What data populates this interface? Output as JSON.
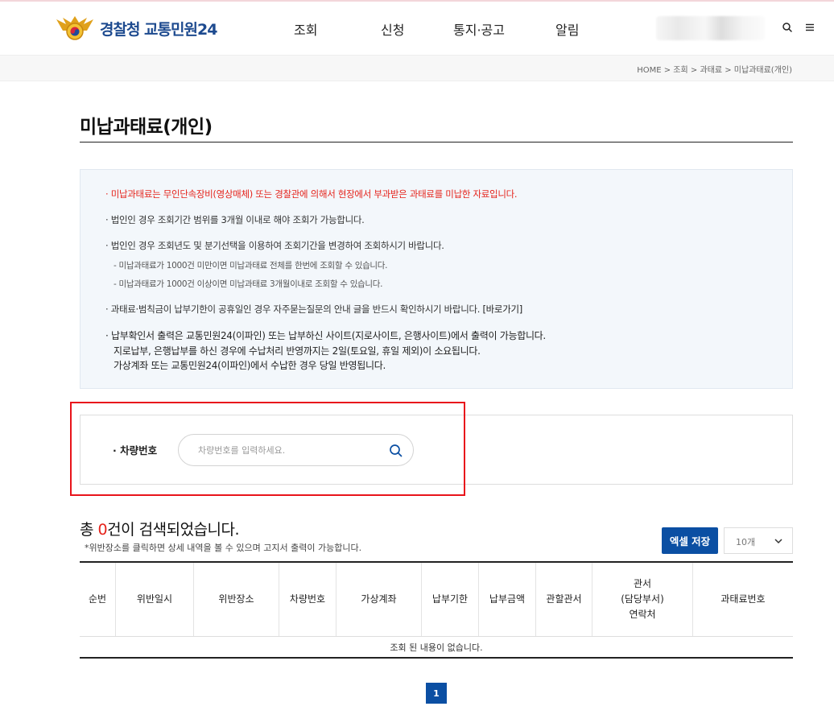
{
  "header": {
    "logo_text": "경찰청 교통민원24",
    "nav": [
      {
        "label": "조회"
      },
      {
        "label": "신청"
      },
      {
        "label": "통지·공고"
      },
      {
        "label": "알림"
      }
    ]
  },
  "breadcrumb": [
    "HOME",
    "조회",
    "과태료",
    "미납과태료(개인)"
  ],
  "page_title": "미납과태료(개인)",
  "notice": {
    "line1": "미납과태료는 무인단속장비(영상매체) 또는 경찰관에 의해서 현장에서 부과받은 과태료를 미납한 자료입니다.",
    "line2": "법인인 경우 조회기간 범위를 3개월 이내로 해야 조회가 가능합니다.",
    "line3": "법인인 경우 조회년도 및 분기선택을 이용하여 조회기간을 변경하여 조회하시기 바랍니다.",
    "line3_sub1": "미납과태료가 1000건 미만이면 미납과태료 전체를 한번에 조회할 수 있습니다.",
    "line3_sub2": "미납과태료가 1000건 이상이면 미납과태료 3개월이내로 조회할 수 있습니다.",
    "line4": "과태료·범칙금이 납부기한이 공휴일인 경우 자주묻는질문의 안내 글을 반드시 확인하시기 바랍니다.",
    "line4_link": "[바로가기]",
    "line5": "납부확인서 출력은 교통민원24(이파인) 또는 납부하신 사이트(지로사이트, 은행사이트)에서 출력이 가능합니다.",
    "line5_2": "지로납부, 은행납부를 하신 경우에 수납처리 반영까지는 2일(토요일, 휴일 제외)이 소요됩니다.",
    "line5_3": "가상계좌 또는 교통민원24(이파인)에서 수납한 경우 당일 반영됩니다."
  },
  "search": {
    "label": "차량번호",
    "placeholder": "차량번호를 입력하세요."
  },
  "result": {
    "prefix": "총 ",
    "count": "0",
    "suffix": "건이 검색되었습니다.",
    "note": "*위반장소를 클릭하면 상세 내역을 볼 수 있으며 고지서 출력이 가능합니다.",
    "excel_label": "엑셀 저장",
    "page_size": "10개"
  },
  "table": {
    "headers": [
      "순번",
      "위반일시",
      "위반장소",
      "차량번호",
      "가상계좌",
      "납부기한",
      "납부금액",
      "관할관서",
      "관서\n(담당부서)\n연락처",
      "과태료번호"
    ],
    "empty_text": "조회 된 내용이 없습니다."
  },
  "pagination": {
    "current": "1"
  },
  "colors": {
    "brand_blue": "#0b4fa3",
    "accent_red": "#e5231b",
    "notice_bg": "#f3f7fb",
    "frame_red": "#e8141b"
  }
}
